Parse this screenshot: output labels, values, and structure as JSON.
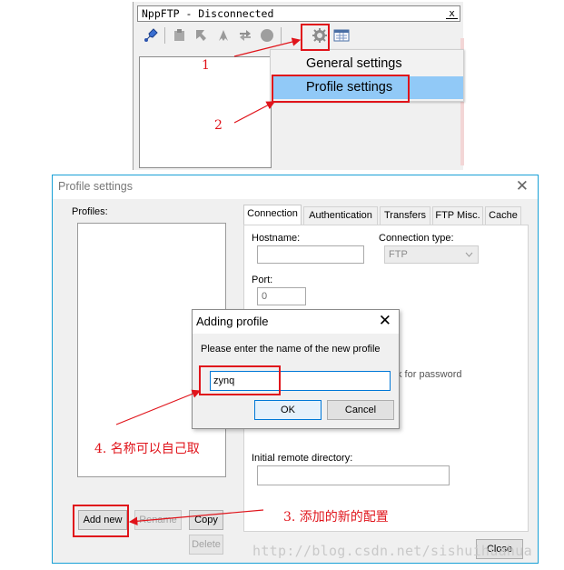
{
  "ftp_panel": {
    "title": "NppFTP - Disconnected",
    "close_glyph": "x",
    "toolbar_icons": [
      "connect-icon",
      "disconnect-icon",
      "download-icon",
      "upload-icon",
      "refresh-icon",
      "abort-icon",
      "settings-icon",
      "message-window-icon"
    ],
    "menu": {
      "items": [
        {
          "label": "General settings",
          "selected": false
        },
        {
          "label": "Profile settings",
          "selected": true
        }
      ]
    }
  },
  "profile_settings": {
    "title": "Profile settings",
    "close_glyph": "✕",
    "profiles_label": "Profiles:",
    "buttons": {
      "add_new": "Add new",
      "rename": "Rename",
      "copy": "Copy",
      "delete": "Delete",
      "close": "Close"
    },
    "tabs": [
      {
        "label": "Connection",
        "active": true
      },
      {
        "label": "Authentication",
        "active": false
      },
      {
        "label": "Transfers",
        "active": false
      },
      {
        "label": "FTP Misc.",
        "active": false
      },
      {
        "label": "Cache",
        "active": false
      }
    ],
    "connection": {
      "hostname_label": "Hostname:",
      "hostname_value": "",
      "connection_type_label": "Connection type:",
      "connection_type_value": "FTP",
      "port_label": "Port:",
      "port_value": "0",
      "ask_password_partial": "k for password",
      "initial_dir_label": "Initial remote directory:",
      "initial_dir_value": ""
    }
  },
  "adding_profile": {
    "title": "Adding profile",
    "close_glyph": "✕",
    "prompt": "Please enter the name of the new profile",
    "input_value": "zynq",
    "ok": "OK",
    "cancel": "Cancel"
  },
  "annotations": {
    "step1": "1",
    "step2": "2",
    "step3": "3. 添加的新的配置",
    "step4": "4. 名称可以自己取"
  },
  "watermark": "http://blog.csdn.net/sishuihuahua",
  "colors": {
    "annotation_red": "#e0141b",
    "selection_blue": "#91c9f7",
    "window_border": "#18a0d6",
    "focus_blue": "#0078d7"
  }
}
